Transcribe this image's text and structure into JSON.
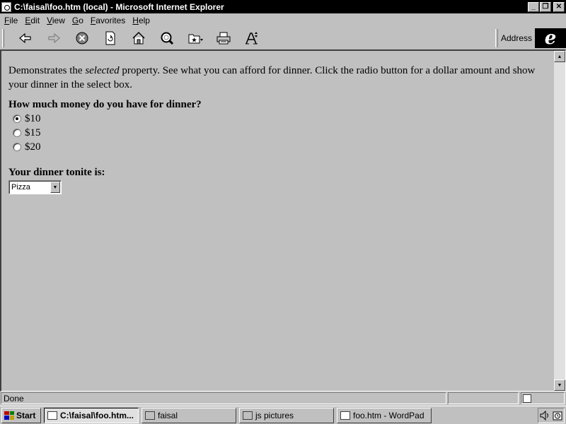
{
  "window": {
    "title": "C:\\faisal\\foo.htm (local) - Microsoft Internet Explorer",
    "buttons": {
      "minimize": "_",
      "restore": "❐",
      "close": "✕"
    }
  },
  "menu": [
    {
      "label": "File",
      "u": "F",
      "rest": "ile"
    },
    {
      "label": "Edit",
      "u": "E",
      "rest": "dit"
    },
    {
      "label": "View",
      "u": "V",
      "rest": "iew"
    },
    {
      "label": "Go",
      "u": "G",
      "rest": "o"
    },
    {
      "label": "Favorites",
      "u": "F",
      "rest": "avorites"
    },
    {
      "label": "Help",
      "u": "H",
      "rest": "elp"
    }
  ],
  "toolbar": {
    "icons": [
      "back-icon",
      "forward-icon",
      "stop-icon",
      "refresh-icon",
      "home-icon",
      "search-icon",
      "favorites-icon",
      "print-icon",
      "font-icon"
    ],
    "address_label": "Address"
  },
  "page": {
    "intro_before": "Demonstrates the ",
    "intro_em": "selected",
    "intro_after": " property. See what you can afford for dinner. Click the radio button for a dollar amount and show your dinner in the select box.",
    "question": "How much money do you have for dinner?",
    "options": [
      {
        "label": "$10",
        "checked": true
      },
      {
        "label": "$15",
        "checked": false
      },
      {
        "label": "$20",
        "checked": false
      }
    ],
    "dinner_label": "Your dinner tonite is:",
    "dinner_value": "Pizza"
  },
  "status": {
    "text": "Done"
  },
  "taskbar": {
    "start_label": "Start",
    "tasks": [
      {
        "label": "C:\\faisal\\foo.htm...",
        "active": true,
        "icon": "ie-page-icon"
      },
      {
        "label": "faisal",
        "active": false,
        "icon": "folder-icon"
      },
      {
        "label": "js pictures",
        "active": false,
        "icon": "folder-icon"
      },
      {
        "label": "foo.htm - WordPad",
        "active": false,
        "icon": "wordpad-icon"
      }
    ]
  }
}
